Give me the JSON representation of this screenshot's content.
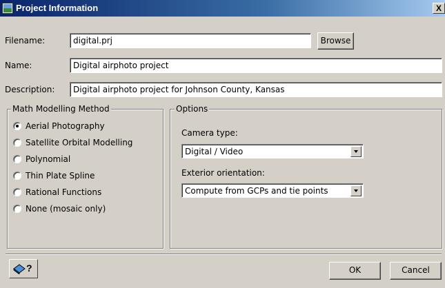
{
  "window": {
    "title": "Project Information",
    "close_glyph": "X"
  },
  "fields": {
    "filename": {
      "label": "Filename:",
      "value": "digital.prj"
    },
    "name": {
      "label": "Name:",
      "value": "Digital airphoto project"
    },
    "description": {
      "label": "Description:",
      "value": "Digital airphoto project for Johnson County, Kansas"
    }
  },
  "browse_label": "Browse",
  "math_modelling": {
    "legend": "Math Modelling Method",
    "options": [
      "Aerial Photography",
      "Satellite Orbital Modelling",
      "Polynomial",
      "Thin Plate Spline",
      "Rational Functions",
      "None (mosaic only)"
    ],
    "selected": "Aerial Photography"
  },
  "options_group": {
    "legend": "Options",
    "camera_type_label": "Camera type:",
    "camera_type_value": "Digital / Video",
    "exterior_orientation_label": "Exterior orientation:",
    "exterior_orientation_value": "Compute from GCPs and tie points"
  },
  "footer": {
    "help_glyph": "?",
    "ok_label": "OK",
    "cancel_label": "Cancel"
  }
}
